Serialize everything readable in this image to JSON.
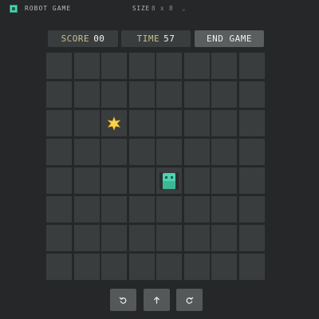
{
  "app": {
    "title": "ROBOT GAME",
    "size_label": "SIZE",
    "size_value": "8 x 8"
  },
  "stats": {
    "score_label": "SCORE",
    "score_value": "00",
    "time_label": "TIME",
    "time_value": "57",
    "end_button_label": "END GAME"
  },
  "board": {
    "rows": 8,
    "cols": 8,
    "star": {
      "row": 2,
      "col": 2
    },
    "robot": {
      "row": 4,
      "col": 4
    }
  },
  "controls": [
    {
      "name": "rotate-left",
      "icon": "rotate-left-icon"
    },
    {
      "name": "move-forward",
      "icon": "arrow-up-icon"
    },
    {
      "name": "rotate-right",
      "icon": "rotate-right-icon"
    }
  ],
  "colors": {
    "background": "#252729",
    "cell": "#3a3d3e",
    "robot": "#4fd3b0",
    "star": "#f7d34a",
    "label_accent": "#c5c08e"
  }
}
